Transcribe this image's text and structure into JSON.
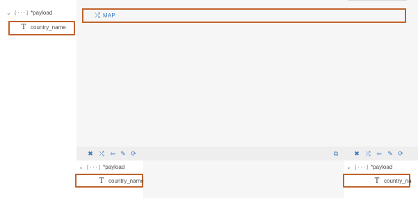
{
  "left_tree": {
    "root_label": "*payload",
    "root_brackets": "[···]",
    "child_label": "country_name"
  },
  "main": {
    "map_label": "MAP"
  },
  "toolbar": {
    "left_icons": [
      "close-icon",
      "shuffle-icon",
      "pin-icon",
      "pencil-icon",
      "refresh-icon"
    ],
    "right_icons": [
      "external-link-icon",
      "close-icon",
      "shuffle-icon",
      "pin-icon",
      "pencil-icon",
      "refresh-icon"
    ]
  },
  "source_tree": {
    "root_label": "*payload",
    "root_brackets": "[···]",
    "child_label": "country_name"
  },
  "target_tree": {
    "root_label": "*payload",
    "root_brackets": "[···]",
    "child_label": "country_na"
  },
  "colors": {
    "accent": "#3a78c4",
    "highlight": "#c0622a",
    "canvas": "#f6f6f6"
  }
}
